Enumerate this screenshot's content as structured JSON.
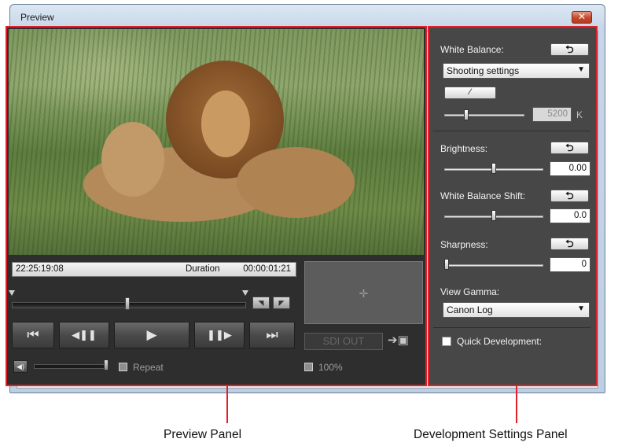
{
  "window": {
    "title": "Preview",
    "close_glyph": "✕"
  },
  "playback": {
    "timecode": "22:25:19:08",
    "duration_label": "Duration",
    "duration": "00:00:01:21",
    "seek_position": 0.5,
    "buttons": [
      {
        "name": "go-to-start",
        "glyph": "⏮"
      },
      {
        "name": "step-back",
        "glyph": "◀❚❚"
      },
      {
        "name": "play",
        "glyph": "▶"
      },
      {
        "name": "step-forward",
        "glyph": "❚❚▶"
      },
      {
        "name": "go-to-end",
        "glyph": "⏭"
      }
    ],
    "in_mark_glyph": "◥",
    "out_mark_glyph": "◤",
    "sdi_out": "SDI OUT",
    "repeat_label": "Repeat",
    "zoom_label": "100%",
    "volume_level": 1.0
  },
  "development": {
    "white_balance_label": "White Balance:",
    "white_balance_value": "Shooting settings",
    "kelvin_value": "5200",
    "kelvin_unit": "K",
    "brightness_label": "Brightness:",
    "brightness_value": "0.00",
    "wb_shift_label": "White Balance Shift:",
    "wb_shift_value": "0.0",
    "sharpness_label": "Sharpness:",
    "sharpness_value": "0",
    "view_gamma_label": "View Gamma:",
    "view_gamma_value": "Canon Log",
    "quick_dev_label": "Quick Development:",
    "reset_glyph": "⮌"
  },
  "callouts": {
    "preview_panel": "Preview Panel",
    "development_panel": "Development Settings Panel"
  },
  "colors": {
    "highlight": "#e0202a",
    "panel_dark": "#2e2e2e",
    "panel_settings": "#474747"
  }
}
